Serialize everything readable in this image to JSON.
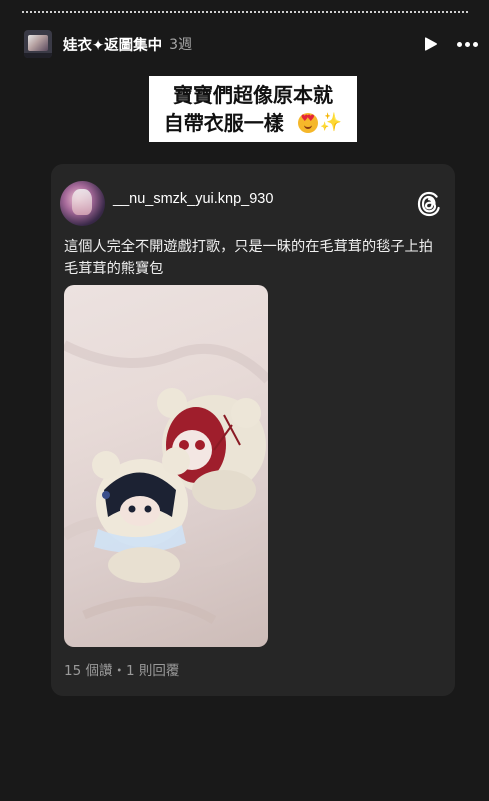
{
  "story": {
    "username": "娃衣✦返圖集中",
    "time": "3週",
    "play_icon": "play-icon",
    "more_icon": "more-icon"
  },
  "sticker": {
    "line1": "寶寶們超像原本就",
    "line2": "自帶衣服一樣"
  },
  "post": {
    "username": "__nu_smzk_yui.knp_930",
    "text": "這個人完全不開遊戲打歌，只是一昧的在毛茸茸的毯子上拍毛茸茸的熊寶包",
    "likes": "15 個讚",
    "separator": "・",
    "replies": "1 則回覆",
    "threads_icon": "threads-logo-icon"
  },
  "colors": {
    "background": "#191919",
    "card": "#262626",
    "muted": "#9a9a9a"
  }
}
